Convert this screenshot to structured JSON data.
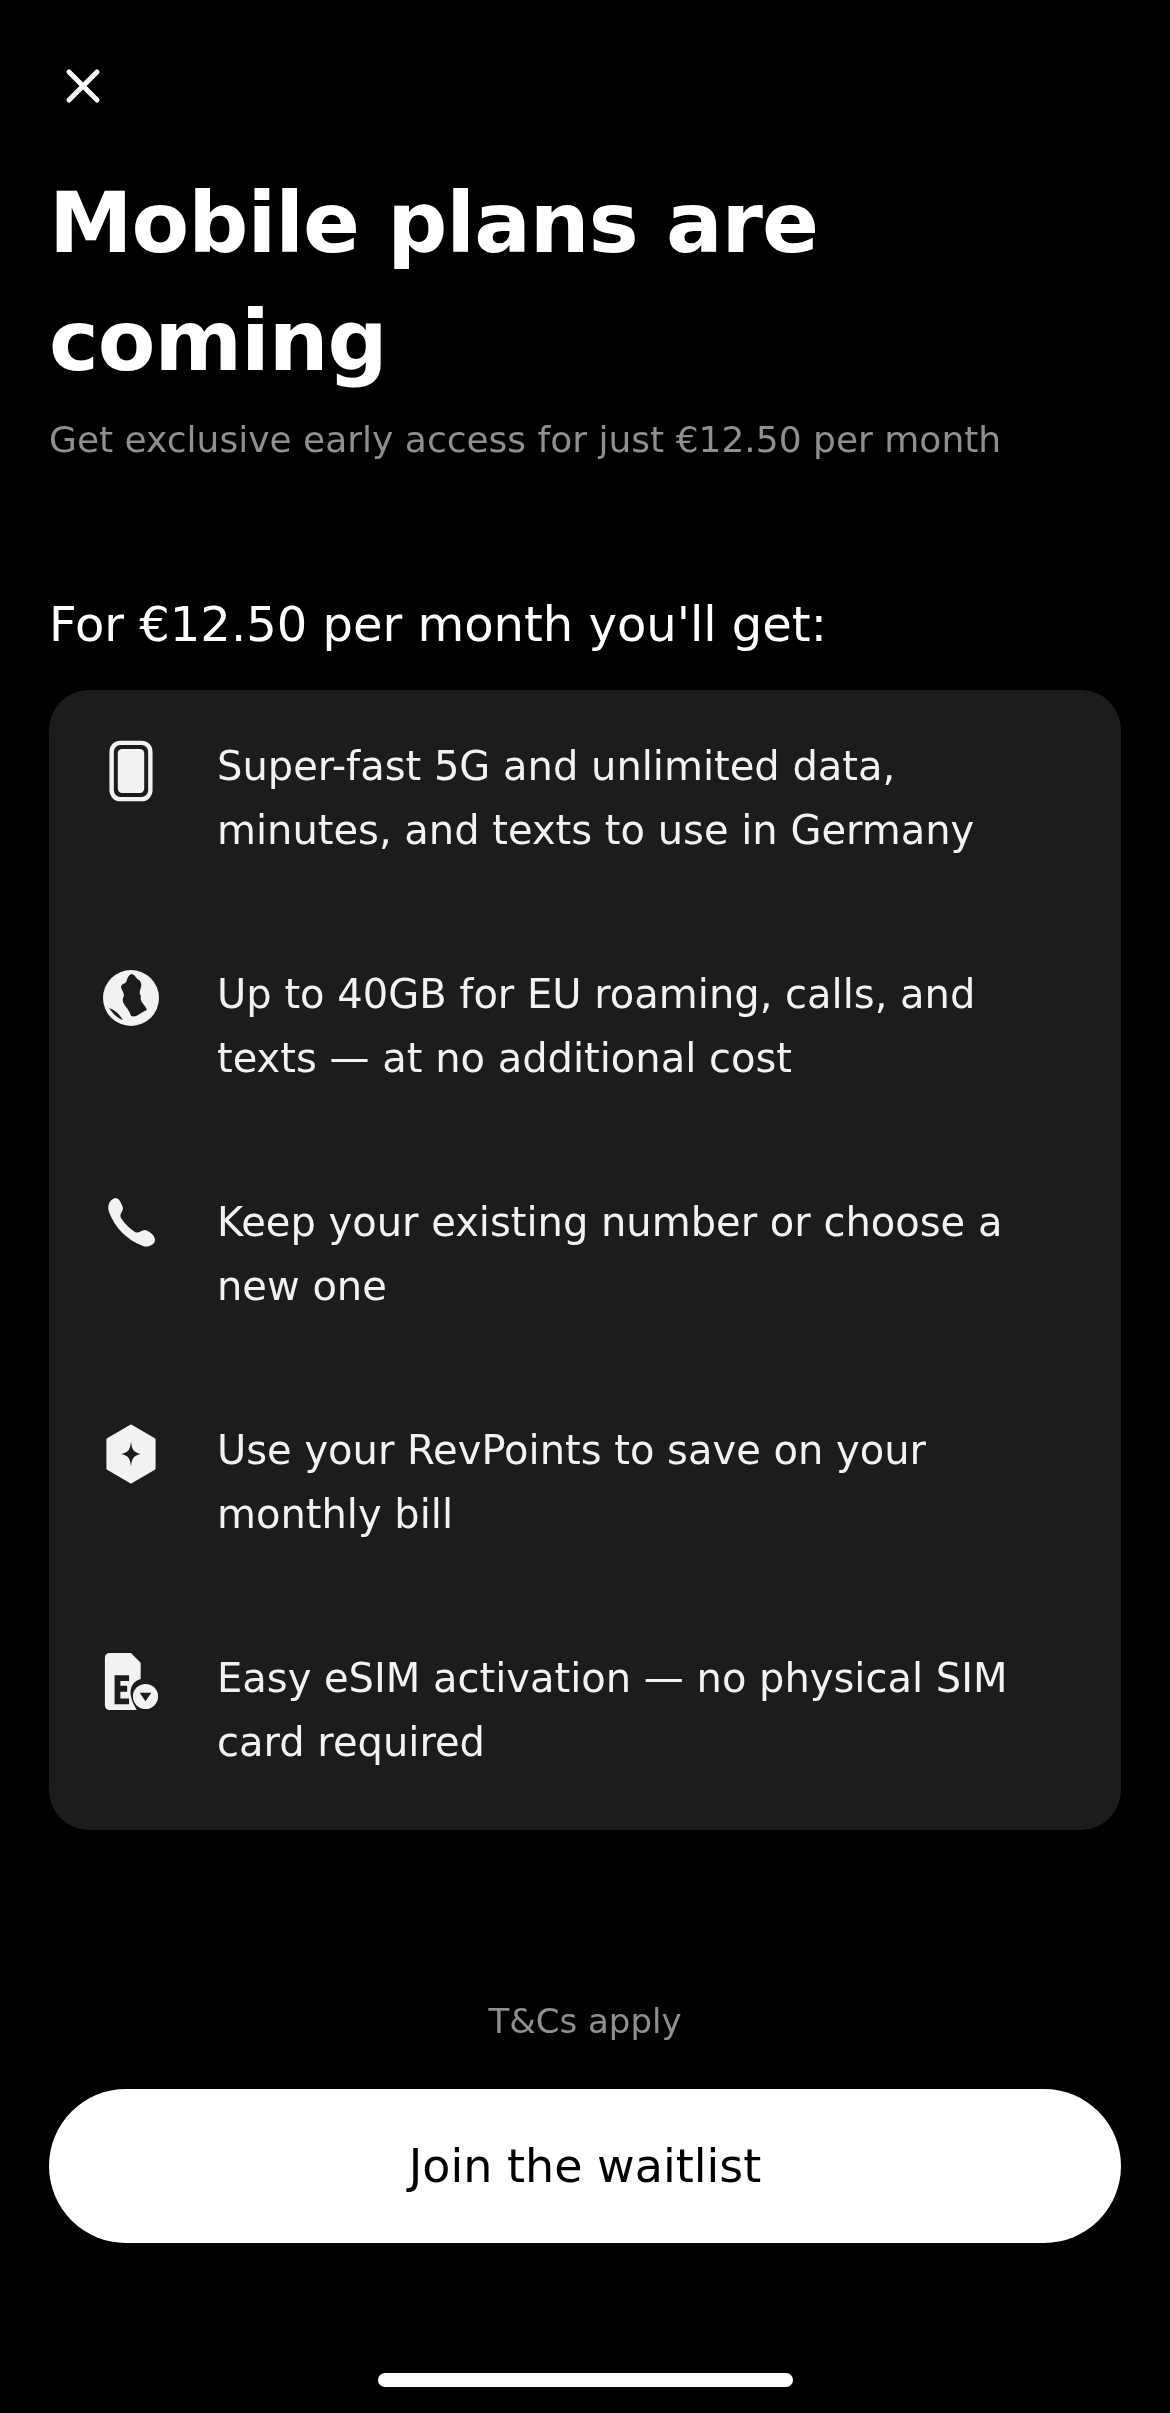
{
  "title": "Mobile plans are coming",
  "subtitle": "Get exclusive early access for just €12.50 per month",
  "benefits_heading": "For €12.50 per month you'll get:",
  "benefits": [
    {
      "kind": "phone",
      "text": "Super-fast 5G and unlimited data, minutes, and texts to use in Germany"
    },
    {
      "kind": "globe",
      "text": "Up to 40GB for EU roaming, calls, and texts — at no additional cost"
    },
    {
      "kind": "call",
      "text": "Keep your existing number or choose a new one"
    },
    {
      "kind": "points",
      "text": "Use your RevPoints to save on your monthly bill"
    },
    {
      "kind": "esim",
      "text": "Easy eSIM activation — no physical SIM card required"
    }
  ],
  "terms": "T&Cs apply",
  "primary_button": "Join the waitlist"
}
